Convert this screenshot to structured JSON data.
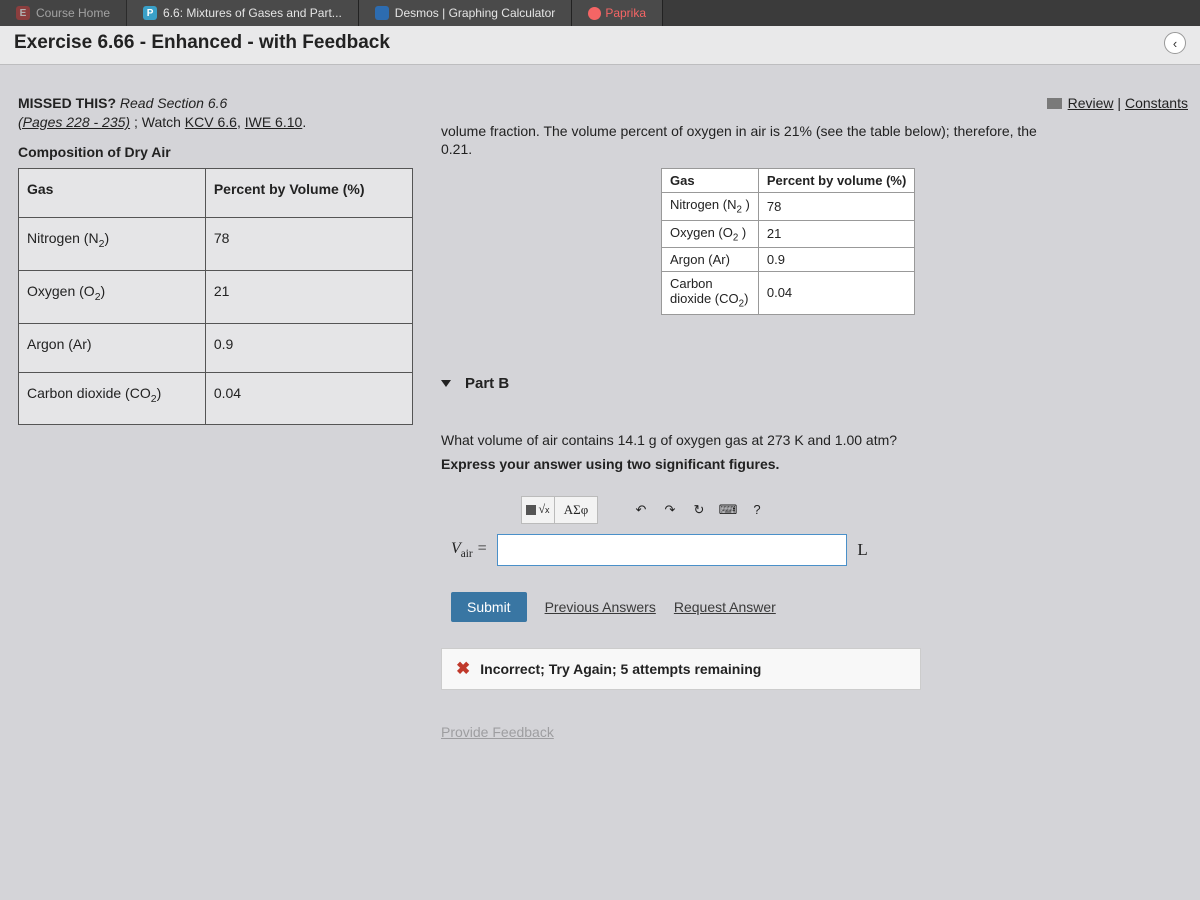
{
  "tabs": [
    {
      "label": "Course Home",
      "favicon_bg": "#c04040",
      "favicon_txt": "E"
    },
    {
      "label": "6.6: Mixtures of Gases and Part...",
      "favicon_bg": "#3aa0c8",
      "favicon_txt": "P"
    },
    {
      "label": "Desmos | Graphing Calculator",
      "favicon_bg": "#2d6cb0",
      "favicon_txt": ""
    },
    {
      "label": "Paprika",
      "favicon_bg": "#f56565",
      "favicon_txt": ""
    }
  ],
  "page_title": "Exercise 6.66 - Enhanced - with Feedback",
  "missed": {
    "prefix": "MISSED THIS? ",
    "read": "Read Section 6.6",
    "pages": "(Pages 228 - 235)",
    "watch_prefix": " ; Watch ",
    "link1": "KCV 6.6",
    "comma": ", ",
    "link2": "IWE 6.10",
    "period": "."
  },
  "composition_title": "Composition of Dry Air",
  "air_table": {
    "headers": [
      "Gas",
      "Percent by Volume (%)"
    ],
    "rows": [
      {
        "gas": "Nitrogen (N",
        "sub": "2",
        "close": ")",
        "val": "78"
      },
      {
        "gas": "Oxygen (O",
        "sub": "2",
        "close": ")",
        "val": "21"
      },
      {
        "gas": "Argon (Ar)",
        "sub": "",
        "close": "",
        "val": "0.9"
      },
      {
        "gas": "Carbon dioxide (CO",
        "sub": "2",
        "close": ")",
        "val": "0.04"
      }
    ]
  },
  "top_links": {
    "review": "Review",
    "constants": "Constants",
    "sep": " | "
  },
  "vol_text_a": "volume fraction. The volume percent of oxygen in air is 21",
  "vol_text_pct": "%",
  "vol_text_b": " (see the table below); therefore, the ",
  "vol_text_c": "0.21.",
  "small_table": {
    "headers": [
      "Gas",
      "Percent by volume (%)"
    ],
    "rows": [
      {
        "gas": "Nitrogen (N",
        "sub": "2",
        "close": " )",
        "val": "78"
      },
      {
        "gas": "Oxygen (O",
        "sub": "2",
        "close": " )",
        "val": "21"
      },
      {
        "gas": "Argon (Ar)",
        "sub": "",
        "close": "",
        "val": "0.9"
      },
      {
        "gas_a": "Carbon",
        "gas_b": "dioxide (CO",
        "sub": "2",
        "close": ")",
        "val": "0.04"
      }
    ]
  },
  "part_label": "Part B",
  "question": "What volume of air contains 14.1 g of oxygen gas at 273 K and 1.00 atm?",
  "instruction": "Express your answer using two significant figures.",
  "toolbar": {
    "template": "▭",
    "root": "√",
    "greek": "ΑΣφ",
    "undo": "↶",
    "redo": "↷",
    "reset": "↻",
    "keyboard": "⌨",
    "help": "?"
  },
  "var_label_a": "V",
  "var_label_b": "air",
  "equals": " = ",
  "unit": "L",
  "submit": "Submit",
  "prev_ans": "Previous Answers",
  "req_ans": "Request Answer",
  "feedback": "Incorrect; Try Again; 5 attempts remaining",
  "provide_feedback": "Provide Feedback"
}
